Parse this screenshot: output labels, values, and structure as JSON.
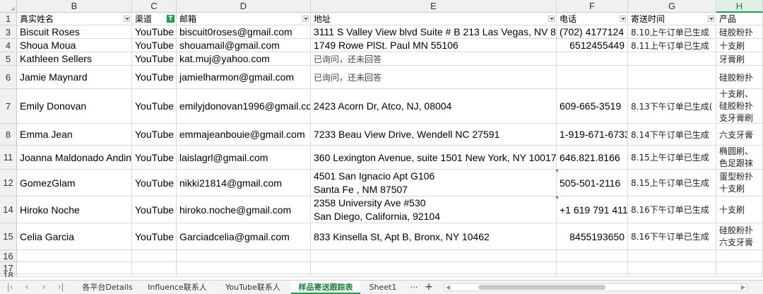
{
  "columns": [
    "B",
    "C",
    "D",
    "E",
    "F",
    "G",
    "H"
  ],
  "header": {
    "row_number": "1",
    "name": "真实姓名",
    "channel": "渠道",
    "email": "邮箱",
    "address": "地址",
    "phone": "电话",
    "send_time": "寄送时间",
    "product": "产品"
  },
  "rows": [
    {
      "num": "3",
      "name": "Biscuit Roses",
      "channel": "YouTube",
      "email": "biscuit0roses@gmail.com",
      "address": [
        "3111 S Valley View blvd Suite # B 213 Las Vegas, NV 89"
      ],
      "phone": "(702) 4177124",
      "time": "8.10上午订单已生成",
      "product": [
        "硅胶粉扑"
      ]
    },
    {
      "num": "4",
      "name": "Shoua Moua",
      "channel": "YouTube",
      "email": "shouamail@gmail.com",
      "address": [
        "1749 Rowe PlSt. Paul MN 55106"
      ],
      "phone": "6512455449",
      "time": "8.11上午订单已生成",
      "product": [
        "十支刷"
      ]
    },
    {
      "num": "5",
      "name": "Kathleen Sellers",
      "channel": "YouTube",
      "email": "kat.muj@yahoo.com",
      "address": [
        "已询问，还未回答"
      ],
      "phone": "",
      "time": "",
      "product": [
        "牙膏刷"
      ]
    },
    {
      "num": "6",
      "name": "Jamie Maynard",
      "channel": "YouTube",
      "email": "jamielharmon@gmail.com",
      "address": [
        "已询问，还未回答"
      ],
      "phone": "",
      "time": "",
      "product": [
        "硅胶粉扑"
      ]
    },
    {
      "num": "7",
      "name": "Emily Donovan",
      "channel": "YouTube",
      "email": "emilyjdonovan1996@gmail.co",
      "address": [
        "2423 Acorn Dr, Atco, NJ, 08004"
      ],
      "phone": "609-665-3519",
      "time": "8.13下午订单已生成(",
      "product": [
        "十支刷、",
        "硅胶粉扑",
        "支牙膏刷"
      ]
    },
    {
      "num": "8",
      "name": "Emma Jean",
      "channel": "YouTube",
      "email": "emmajeanbouie@gmail.com",
      "address": [
        "7233 Beau View Drive, Wendell NC 27591"
      ],
      "phone": "1-919-671-6733",
      "time": "8.14下午订单已生成",
      "product": [
        "六支牙膏"
      ]
    },
    {
      "num": "11",
      "name": "Joanna Maldonado Andin",
      "channel": "YouTube",
      "email": "laislagrl@gmail.com",
      "address": [
        "360 Lexington Avenue, suite 1501 New York, NY 10017"
      ],
      "phone": "646.821.8166",
      "time": "8.15上午订单已生成",
      "product": [
        "椭圆刷、",
        "色足跟袜"
      ]
    },
    {
      "num": "12",
      "name": "GomezGlam",
      "channel": "YouTube",
      "email": "nikki21814@gmail.com",
      "address": [
        "4501 San Ignacio Apt G106",
        "Santa Fe , NM 87507"
      ],
      "phone": "505-501-2116",
      "time": "8.15上午订单已生成",
      "product": [
        "蛋型粉扑",
        "十支刷"
      ]
    },
    {
      "num": "14",
      "name": "Hiroko Noche",
      "channel": "YouTube",
      "email": "hiroko.noche@gmail.com",
      "address": [
        "2358 University Ave #530",
        "San Diego, California, 92104"
      ],
      "phone": "+1 619 791 411",
      "time": "8.16下午订单已生成",
      "product": [
        "十支刷"
      ]
    },
    {
      "num": "15",
      "name": "Celia Garcia",
      "channel": "YouTube",
      "email": "Garciadcelia@gmail.com",
      "address": [
        "833 Kinsella St, Apt B, Bronx, NY 10462"
      ],
      "phone": "8455193650",
      "time": "8.16下午订单已生成",
      "product": [
        "硅胶粉扑",
        "六支牙膏"
      ]
    }
  ],
  "empty_rows": [
    "16",
    "17",
    "18"
  ],
  "tabs": [
    "各平台Details",
    "Influence联系人",
    "YouTube联系人",
    "样品寄送跟踪表",
    "Sheet1"
  ],
  "active_tab": "样品寄送跟踪表",
  "tab_more": "···",
  "tab_add": "+",
  "accent_color": "#1e9e4a"
}
